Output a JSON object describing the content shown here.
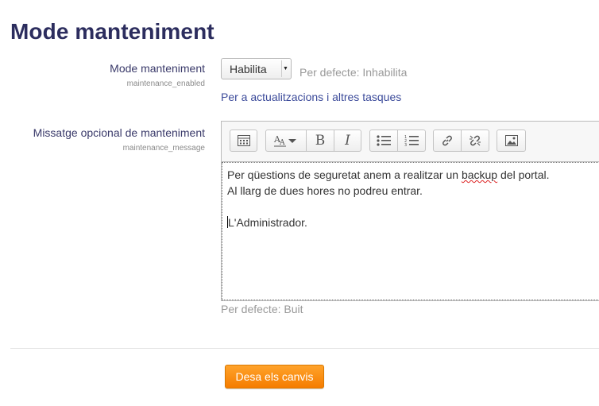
{
  "page_title": "Mode manteniment",
  "maintenance_mode": {
    "label": "Mode manteniment",
    "setting_name": "maintenance_enabled",
    "select_value": "Habilita",
    "default_text": "Per defecte: Inhabilita",
    "link_text": "Per a actualitzacions i altres tasques"
  },
  "maintenance_message": {
    "label": "Missatge opcional de manteniment",
    "setting_name": "maintenance_message",
    "default_text": "Per defecte: Buit",
    "editor": {
      "toolbar_icons": [
        "toolbar-toggle-icon",
        "font-size-icon",
        "bold-icon",
        "italic-icon",
        "bullet-list-icon",
        "numbered-list-icon",
        "link-icon",
        "unlink-icon",
        "image-icon"
      ],
      "bold_glyph": "B",
      "italic_glyph": "I",
      "lines": [
        "Per qüestions de seguretat anem a realitzar un ",
        "backup",
        " del portal.",
        "Al llarg de dues hores no podreu entrar.",
        "L'Administrador."
      ]
    }
  },
  "save_button": "Desa els canvis",
  "colors": {
    "title": "#2c2d5e",
    "link": "#3b4a9a",
    "button": "#f57c00"
  }
}
